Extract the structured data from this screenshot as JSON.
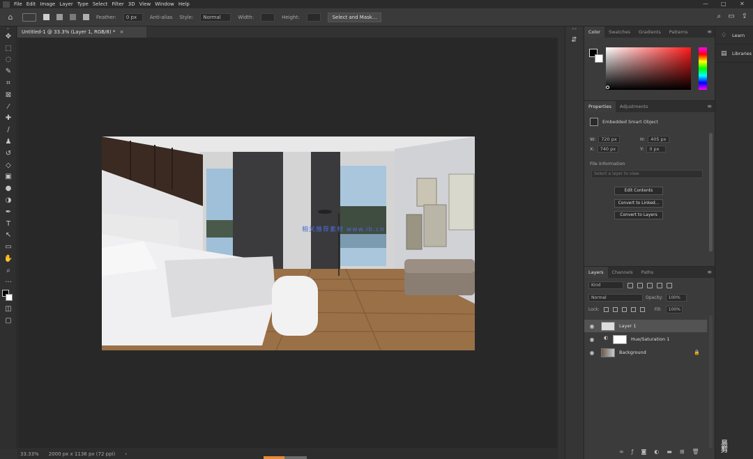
{
  "menubar": {
    "items": [
      "File",
      "Edit",
      "Image",
      "Layer",
      "Type",
      "Select",
      "Filter",
      "3D",
      "View",
      "Window",
      "Help"
    ],
    "window_controls": {
      "minimize": "—",
      "maximize": "□",
      "close": "✕"
    }
  },
  "options_bar": {
    "feather_label": "Feather:",
    "feather_value": "0 px",
    "antialias_label": "Anti-alias",
    "style_label": "Style:",
    "style_value": "Normal",
    "width_label": "Width:",
    "height_label": "Height:",
    "select_mask_button": "Select and Mask..."
  },
  "document": {
    "tab_title": "Untitled-1 @ 33.3% (Layer 1, RGB/8) *",
    "close_glyph": "×",
    "watermark": "相关推荐素材 www.ib.cn",
    "status_zoom": "33.33%",
    "status_info": "2000 px x 1136 px (72 ppi)",
    "status_arrow": "›"
  },
  "color_panel": {
    "tabs": [
      "Color",
      "Swatches",
      "Gradients",
      "Patterns"
    ],
    "active_tab": 0,
    "fg_color": "#000000",
    "bg_color": "#ffffff",
    "hue_color": "#ff1a1a"
  },
  "properties_panel": {
    "tabs": [
      "Properties",
      "Adjustments"
    ],
    "active_tab": 0,
    "kind_label": "Embedded Smart Object",
    "w_label": "W:",
    "w_value": "720 px",
    "h_label": "H:",
    "h_value": "405 px",
    "x_label": "X:",
    "x_value": "740 px",
    "y_label": "Y:",
    "y_value": "0 px",
    "file_section": "File Information",
    "file_placeholder": "Select a layer to view",
    "buttons": [
      "Edit Contents",
      "Convert to Linked...",
      "Convert to Layers"
    ]
  },
  "layers_panel": {
    "tabs": [
      "Layers",
      "Channels",
      "Paths"
    ],
    "active_tab": 0,
    "filter_kind": "Kind",
    "blend_mode": "Normal",
    "opacity_label": "Opacity:",
    "opacity_value": "100%",
    "lock_label": "Lock:",
    "fill_label": "Fill:",
    "fill_value": "100%",
    "layers": [
      {
        "name": "Layer 1",
        "selected": true,
        "has_mask": false,
        "locked": false
      },
      {
        "name": "Hue/Saturation 1",
        "selected": false,
        "has_mask": true,
        "locked": false
      },
      {
        "name": "Background",
        "selected": false,
        "has_mask": false,
        "locked": true
      }
    ],
    "footer_icons": [
      "link",
      "fx",
      "mask",
      "adjustment",
      "group",
      "new-layer",
      "delete"
    ]
  },
  "right_column": {
    "items": [
      "Learn",
      "Libraries"
    ]
  },
  "tools": [
    "move",
    "marquee",
    "lasso",
    "quick-select",
    "crop",
    "frame",
    "eyedropper",
    "healing",
    "brush",
    "clone-stamp",
    "history-brush",
    "eraser",
    "gradient",
    "blur",
    "dodge",
    "pen",
    "type",
    "path-select",
    "rectangle",
    "hand",
    "zoom",
    "more"
  ]
}
